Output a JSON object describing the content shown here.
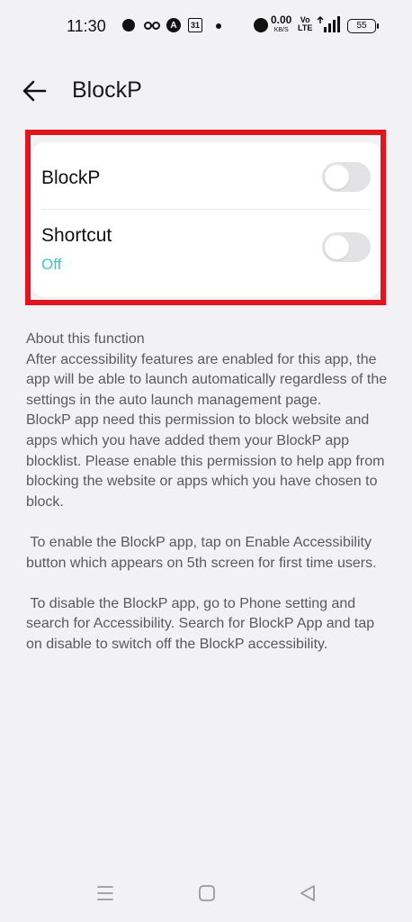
{
  "status_bar": {
    "time": "11:30",
    "calendar_day": "31",
    "alpha_glyph": "A",
    "net_speed": "0.00",
    "net_unit": "KB/S",
    "volte_top": "Vo",
    "volte_bottom": "LTE",
    "battery": "55",
    "icons": [
      "notification-dot-icon",
      "glasses-icon",
      "alpha-icon",
      "calendar-icon",
      "small-dot-icon",
      "alarm-icon",
      "signal-icon",
      "battery-icon"
    ]
  },
  "header": {
    "title": "BlockP",
    "back_icon": "arrow-left-icon"
  },
  "settings": {
    "blockp_label": "BlockP",
    "blockp_enabled": false,
    "shortcut_label": "Shortcut",
    "shortcut_sub": "Off",
    "shortcut_enabled": false,
    "highlight_color": "#e0151d",
    "accent_color": "#38c6c9"
  },
  "about": {
    "title": "About this function",
    "para1": "After accessibility features are enabled for this app, the app will be able to launch automatically regardless of the settings in the auto launch management page.",
    "para2": "BlockP app need this permission to block website and apps which you have added them your BlockP app blocklist. Please enable this permission to help app from blocking the website or apps which you have chosen to block.",
    "para3": " To enable the BlockP app, tap on Enable Accessibility button which appears on 5th screen for first time users.",
    "para4": " To disable the BlockP app, go to Phone setting and search for Accessibility. Search for BlockP App and tap on disable to switch off the BlockP accessibility."
  },
  "nav": {
    "icons": [
      "menu-icon",
      "home-icon",
      "back-triangle-icon"
    ]
  }
}
